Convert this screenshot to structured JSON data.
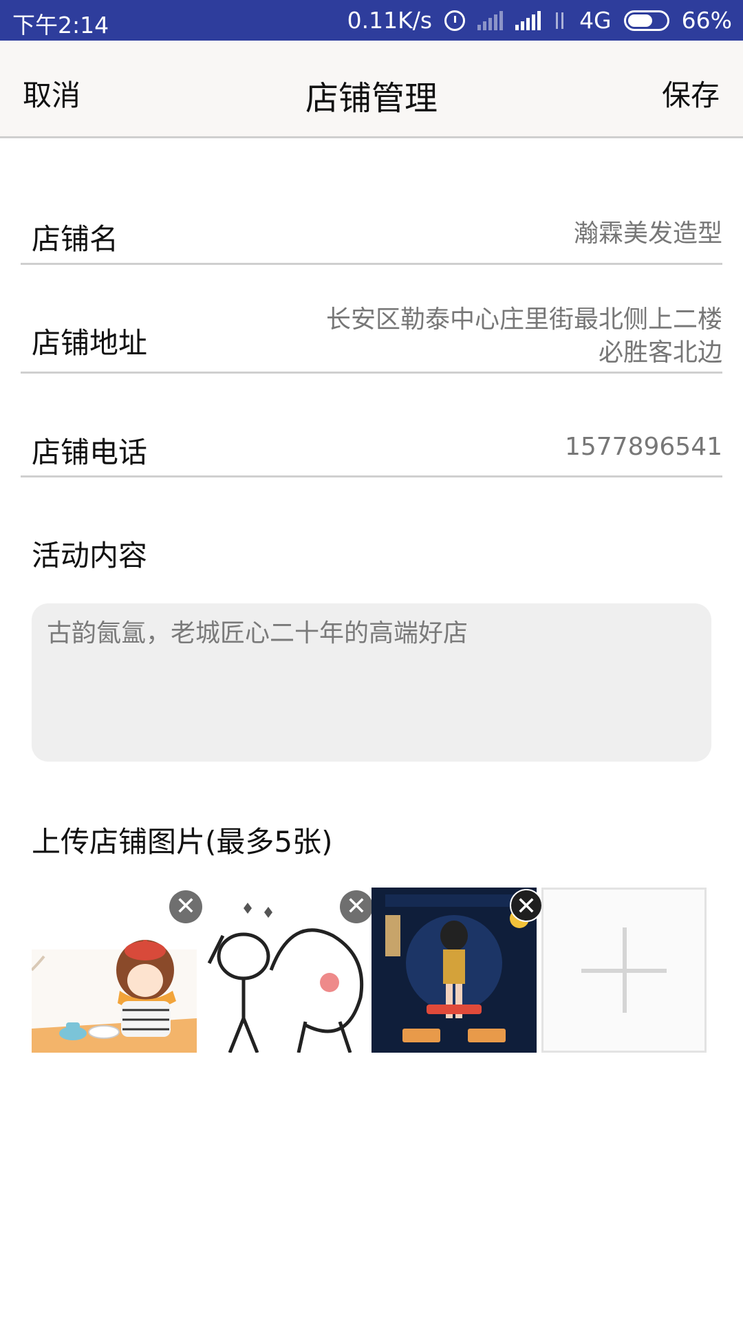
{
  "status_bar": {
    "time": "下午2:14",
    "speed": "0.11K/s",
    "network": "4G",
    "battery": "66%",
    "battery_level": 0.66,
    "icons": [
      "alarm-icon",
      "signal-icon",
      "signal-icon",
      "data-arrows-icon",
      "battery-icon"
    ]
  },
  "nav": {
    "cancel": "取消",
    "title": "店铺管理",
    "save": "保存"
  },
  "form": {
    "name_label": "店铺名",
    "name_value": "瀚霖美发造型",
    "address_label": "店铺地址",
    "address_line1": "长安区勒泰中心庄里街最北侧上二楼",
    "address_line2": "必胜客北边",
    "phone_label": "店铺电话",
    "phone_value": "1577896541"
  },
  "activity": {
    "label": "活动内容",
    "text": "古韵氤氲，老城匠心二十年的高端好店"
  },
  "upload": {
    "label": "上传店铺图片(最多5张)",
    "remove_glyph": "✕",
    "images": [
      {
        "name": "uploaded-image-girl"
      },
      {
        "name": "uploaded-image-sketch"
      },
      {
        "name": "uploaded-image-game"
      }
    ],
    "add_icon": "plus-icon"
  }
}
